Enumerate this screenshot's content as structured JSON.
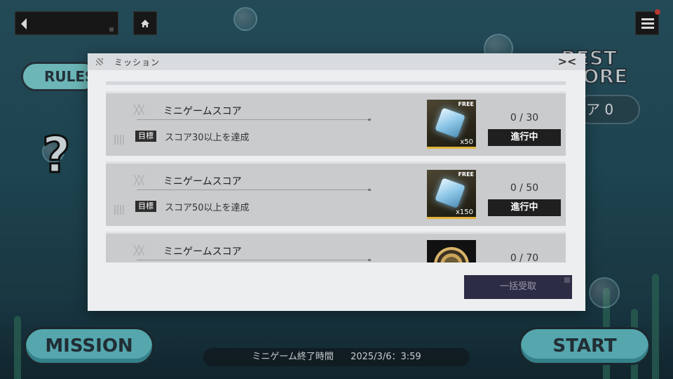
{
  "background": {
    "rules_label": "RULES",
    "best_score_label": "BEST\nSCORE",
    "best_score_value": "ア 0"
  },
  "buttons": {
    "mission": "MISSION",
    "start": "START",
    "claim_all": "一括受取"
  },
  "end_time": {
    "label": "ミニゲーム終了時間",
    "value": "2025/3/6：3:59"
  },
  "modal": {
    "title": "ミッション",
    "missions": [
      {
        "title": "ミニゲームスコア",
        "tag": "目標",
        "goal": "スコア30以上を達成",
        "reward_free": "FREE",
        "reward_qty": "x50",
        "progress": "0 / 30",
        "status": "進行中",
        "reward_icon": "crystal-cube-icon"
      },
      {
        "title": "ミニゲームスコア",
        "tag": "目標",
        "goal": "スコア50以上を達成",
        "reward_free": "FREE",
        "reward_qty": "x150",
        "progress": "0 / 50",
        "status": "進行中",
        "reward_icon": "crystal-cube-icon"
      },
      {
        "title": "ミニゲームスコア",
        "tag": "",
        "goal": "",
        "reward_free": "",
        "reward_qty": "",
        "progress": "0 / 70",
        "status": "",
        "reward_icon": "gold-medal-icon"
      }
    ]
  },
  "colors": {
    "accent_button": "#64c3cc",
    "status_bg": "#1f1f1f",
    "claim_bg": "#2d2c45"
  }
}
